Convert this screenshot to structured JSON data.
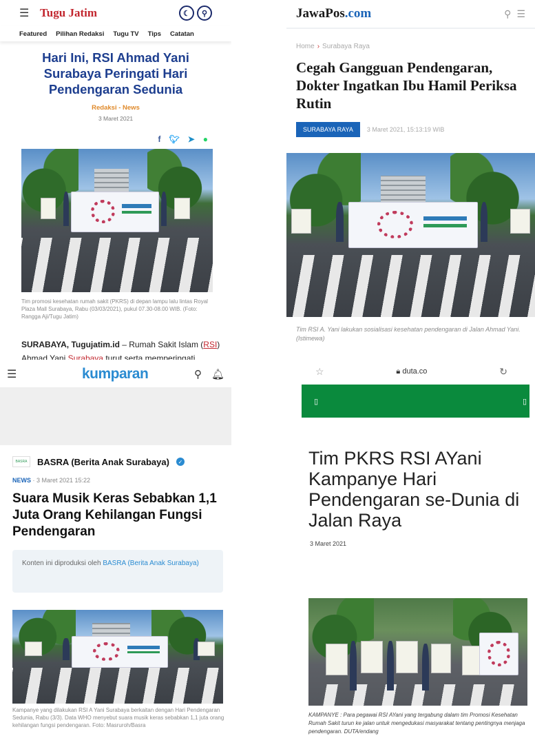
{
  "tugujatim": {
    "logo": "Tugu Jatim",
    "nav": [
      "Featured",
      "Pilihan Redaksi",
      "Tugu TV",
      "Tips",
      "Catatan"
    ],
    "title": "Hari Ini, RSI Ahmad Yani Surabaya Peringati Hari Pendengaran Sedunia",
    "meta_author": "Redaksi",
    "meta_sep": " - ",
    "meta_cat": "News",
    "date": "3 Maret 2021",
    "caption": "Tim promosi kesehatan rumah sakit (PKRS) di depan lampu lalu lintas Royal Plaza Mall Surabaya, Rabu (03/03/2021), pukul 07.30-08.00 WIB. (Foto: Rangga Aji/Tugu Jatim)",
    "body_lead": "SURABAYA, Tugujatim.id",
    "body_a": " – Rumah Sakit Islam (",
    "body_link1": "RSI",
    "body_b": ") Ahmad Yani ",
    "body_link2": "Surabaya",
    "body_c": " turut serta memperingati"
  },
  "jawapos": {
    "logo_main": "JawaPos",
    "logo_dot": ".com",
    "crumb_home": "Home",
    "crumb_sep": "›",
    "crumb_section": "Surabaya Raya",
    "title": "Cegah Gangguan Pendengaran, Dokter Ingatkan Ibu Hamil Periksa Rutin",
    "badge": "SURABAYA RAYA",
    "date": "3 Maret 2021, 15:13:19 WIB",
    "caption": "Tim RSI A. Yani lakukan sosialisasi kesehatan pendengaran di Jalan Ahmad Yani. (Istimewa)"
  },
  "kumparan": {
    "logo": "kumparan",
    "author_avatar": "BASRA",
    "author": "BASRA (Berita Anak Surabaya)",
    "meta_cat": "NEWS",
    "meta_rest": " · 3 Maret 2021 15:22",
    "title": "Suara Musik Keras Sebabkan 1,1 Juta Orang Kehilangan Fungsi Pendengaran",
    "note_prefix": "Konten ini diproduksi oleh ",
    "note_link": "BASRA (Berita Anak Surabaya)",
    "caption": "Kampanye yang dilakukan RSI A Yani Surabaya berkaitan dengan Hari Pendengaran Sedunia, Rabu (3/3). Data WHO menyebut suara musik keras sebabkan 1,1 juta orang kehilangan fungsi pendengaran. Foto: Masruroh/Basra"
  },
  "duta": {
    "url": "duta.co",
    "title": "Tim PKRS RSI AYani Kampanye Hari Pendengaran se-Dunia di Jalan Raya",
    "date": "3 Maret 2021",
    "caption": "KAMPANYE : Para pegawai RSI AYani yang tergabung dalam tim Promosi Kesehatan Rumah Sakit turun ke jalan untuk mengedukasi masyarakat tentang pentingnya menjaga pendengaran. DUTA/endang"
  }
}
